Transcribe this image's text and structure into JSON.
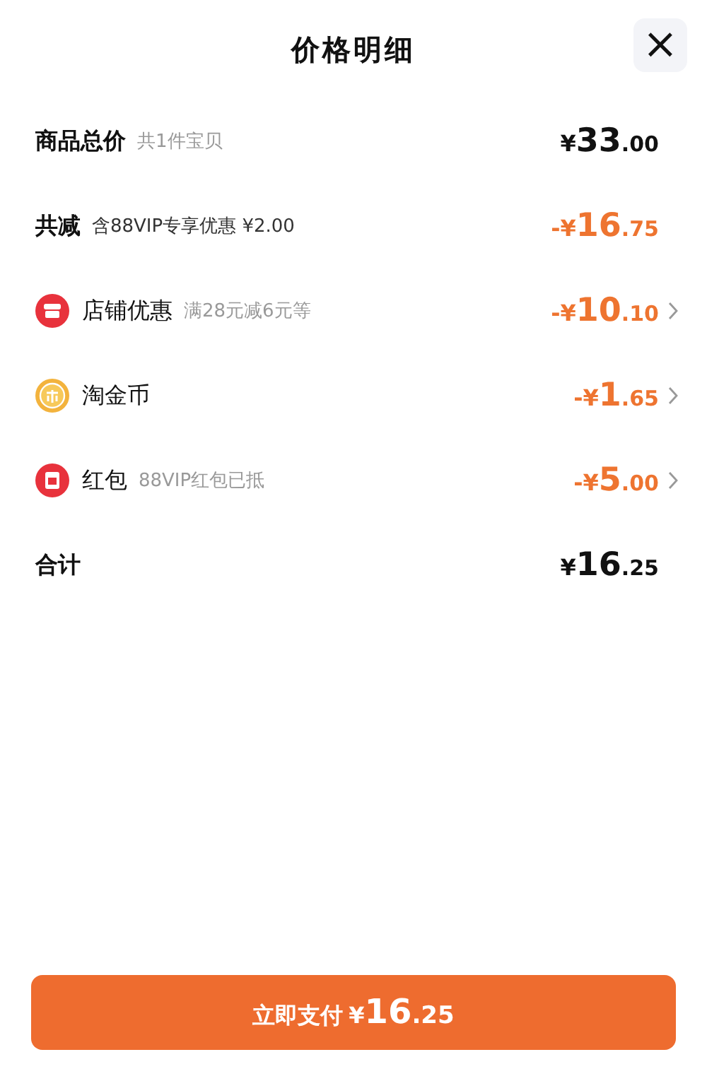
{
  "header": {
    "title": "价格明细",
    "close": "×"
  },
  "rows": [
    {
      "kind": "total",
      "label": "商品总价",
      "note": "共1件宝贝",
      "amount": {
        "currency": "¥",
        "whole": "33",
        "fraction": ".00"
      }
    },
    {
      "kind": "saving",
      "label": "共减",
      "note": "含88VIP专享优惠 ¥2.00",
      "amount": {
        "currency": "-¥",
        "whole": "16",
        "fraction": ".75"
      }
    },
    {
      "kind": "store",
      "label": "店铺优惠",
      "note": "满28元减6元等",
      "amount": {
        "currency": "-¥",
        "whole": "10",
        "fraction": ".10"
      }
    },
    {
      "kind": "coin",
      "label": "淘金币",
      "amount": {
        "currency": "-¥",
        "whole": "1",
        "fraction": ".65"
      }
    },
    {
      "kind": "packet",
      "label": "红包",
      "note": "88VIP红包已抵",
      "amount": {
        "currency": "-¥",
        "whole": "5",
        "fraction": ".00"
      }
    },
    {
      "kind": "sum",
      "label": "合计",
      "amount": {
        "currency": "¥",
        "whole": "16",
        "fraction": ".25"
      }
    }
  ],
  "pay_button": {
    "label": "立即支付",
    "amount": {
      "currency": "¥",
      "whole": "16",
      "fraction": ".25"
    }
  }
}
